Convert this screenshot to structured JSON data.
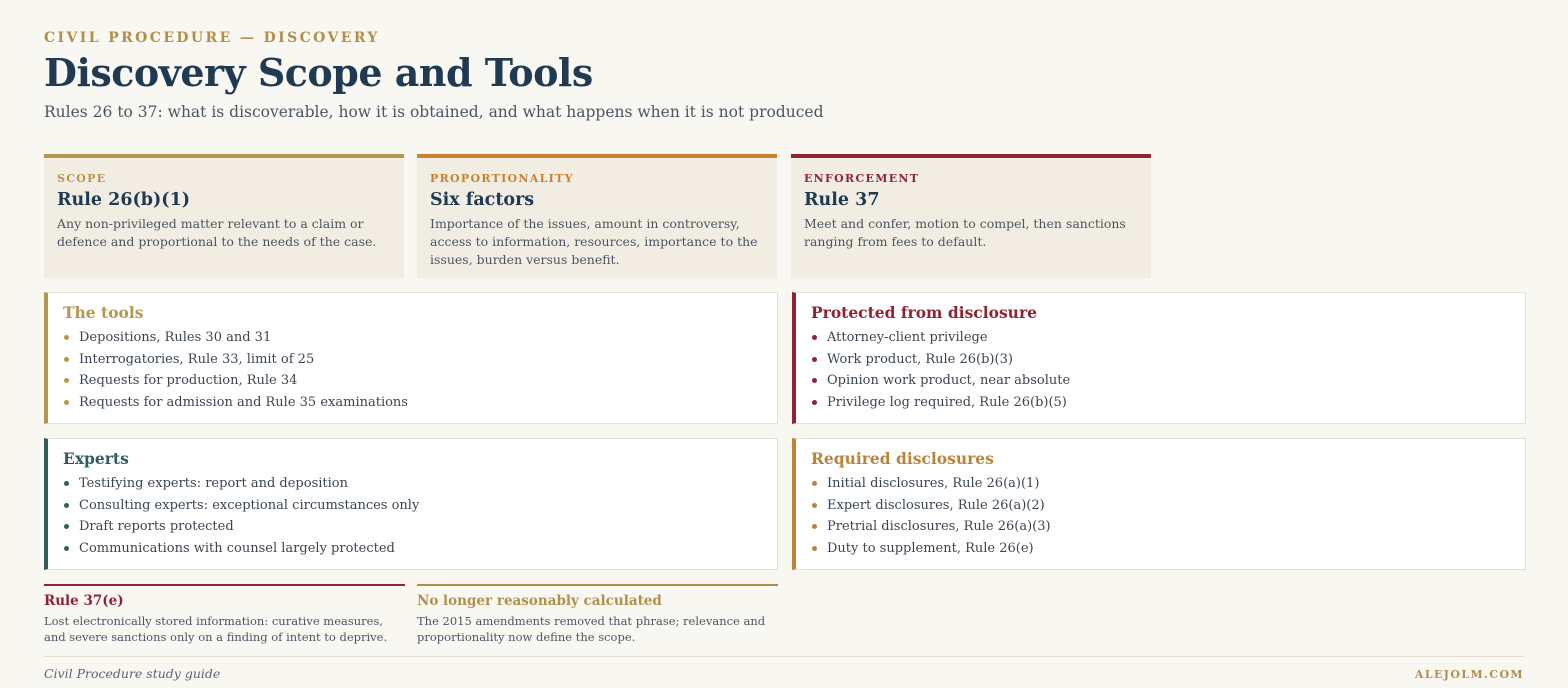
{
  "header": {
    "kicker": "CIVIL PROCEDURE — DISCOVERY",
    "title": "Discovery Scope and Tools",
    "subtitle": "Rules 26 to 37: what is discoverable, how it is obtained, and what happens when it is not produced"
  },
  "cards": [
    {
      "label": "SCOPE",
      "heading": "Rule 26(b)(1)",
      "body": "Any non-privileged matter relevant to a claim or defence and proportional to the needs of the case.",
      "color": "#b8954c"
    },
    {
      "label": "PROPORTIONALITY",
      "heading": "Six factors",
      "body": "Importance of the issues, amount in controversy, access to information, resources, importance to the issues, burden versus benefit.",
      "color": "#c8822e"
    },
    {
      "label": "ENFORCEMENT",
      "heading": "Rule 37",
      "body": "Meet and confer, motion to compel, then sanctions ranging from fees to default.",
      "color": "#8e2433"
    }
  ],
  "boxes": {
    "tools": {
      "title": "The tools",
      "color": "#b8954c",
      "items": [
        "Depositions, Rules 30 and 31",
        "Interrogatories, Rule 33, limit of 25",
        "Requests for production, Rule 34",
        "Requests for admission and Rule 35 examinations"
      ]
    },
    "protected": {
      "title": "Protected from disclosure",
      "color": "#8e2433",
      "items": [
        "Attorney-client privilege",
        "Work product, Rule 26(b)(3)",
        "Opinion work product, near absolute",
        "Privilege log required, Rule 26(b)(5)"
      ]
    },
    "experts": {
      "title": "Experts",
      "color": "#2e5f5a",
      "items": [
        "Testifying experts: report and deposition",
        "Consulting experts: exceptional circumstances only",
        "Draft reports protected",
        "Communications with counsel largely protected"
      ]
    },
    "required": {
      "title": "Required disclosures",
      "color": "#b8843a",
      "items": [
        "Initial disclosures, Rule 26(a)(1)",
        "Expert disclosures, Rule 26(a)(2)",
        "Pretrial disclosures, Rule 26(a)(3)",
        "Duty to supplement, Rule 26(e)"
      ]
    }
  },
  "notes": [
    {
      "title": "Rule 37(e)",
      "body": "Lost electronically stored information: curative measures, and severe sanctions only on a finding of intent to deprive.",
      "color": "#8e2433"
    },
    {
      "title": "No longer reasonably calculated",
      "body": "The 2015 amendments removed that phrase; relevance and proportionality now define the scope.",
      "color": "#b08f4a"
    }
  ],
  "footer": {
    "left": "Civil Procedure study guide",
    "right": "ALEJOLM.COM"
  }
}
